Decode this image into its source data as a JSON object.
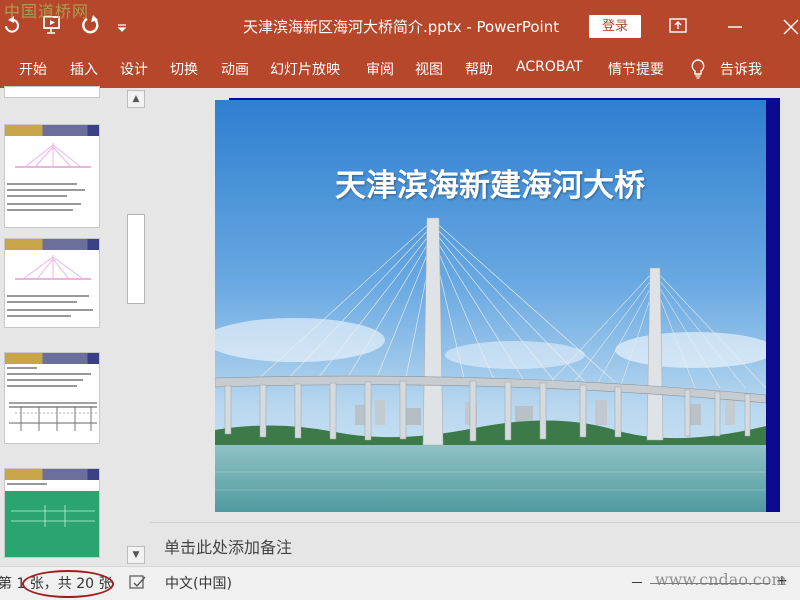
{
  "window": {
    "title": "天津滨海新区海河大桥简介.pptx  -  PowerPoint",
    "login_label": "登录",
    "accent_color": "#b7472a",
    "qat_icons": [
      "undo-icon",
      "slideshow-from-start-icon",
      "redo-icon",
      "customize-qat-icon"
    ],
    "window_icons": [
      "ribbon-display-options-icon",
      "minimize-icon",
      "close-icon"
    ]
  },
  "ribbon": {
    "tabs": [
      "开始",
      "插入",
      "设计",
      "切换",
      "动画",
      "幻灯片放映",
      "审阅",
      "视图",
      "帮助",
      "ACROBAT",
      "情节提要"
    ],
    "tell_me": "告诉我"
  },
  "slide": {
    "title": "天津滨海新建海河大桥"
  },
  "notes": {
    "placeholder": "单击此处添加备注"
  },
  "status": {
    "slide_counter": "第 1 张，共 20 张",
    "language": "中文(中国)",
    "zoom_minus": "－",
    "zoom_plus": "+"
  },
  "watermarks": {
    "top_left": "中国道桥网",
    "bottom_right": "www.cndao.com"
  }
}
